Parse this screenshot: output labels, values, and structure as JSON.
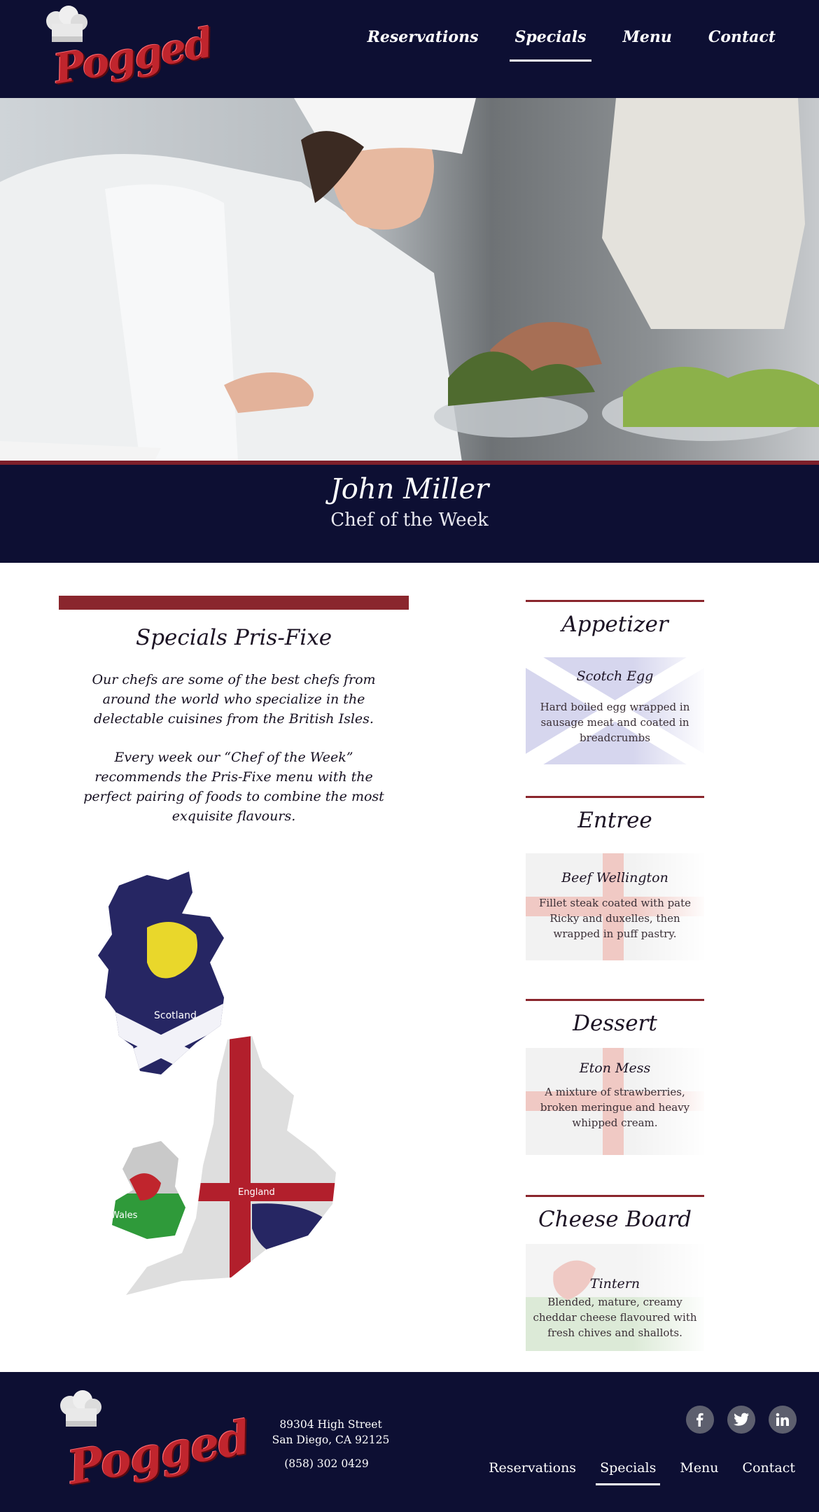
{
  "brand": {
    "logo_text": "Pogged"
  },
  "nav": {
    "items": [
      {
        "label": "Reservations",
        "active": false
      },
      {
        "label": "Specials",
        "active": true
      },
      {
        "label": "Menu",
        "active": false
      },
      {
        "label": "Contact",
        "active": false
      }
    ]
  },
  "hero": {
    "chef_name": "John Miller",
    "chef_role": "Chef of the Week"
  },
  "specials": {
    "title": "Specials Pris-Fixe",
    "paragraph_1": "Our chefs are some of the best chefs from around the world who specialize in the delectable cuisines from the British Isles.",
    "paragraph_2": "Every week our “Chef of the Week” recommends the Pris-Fixe menu with the perfect pairing of foods to combine the most exquisite flavours."
  },
  "map": {
    "labels": {
      "scotland": "Scotland",
      "england": "England",
      "wales": "Wales"
    }
  },
  "courses": [
    {
      "title": "Appetizer",
      "dish": "Scotch Egg",
      "description": "Hard boiled egg wrapped in sausage meat and coated in breadcrumbs",
      "flag": "scotland-flag"
    },
    {
      "title": "Entree",
      "dish": "Beef Wellington",
      "description": "Fillet steak coated with pate Ricky and duxelles, then wrapped in puff pastry.",
      "flag": "england-flag"
    },
    {
      "title": "Dessert",
      "dish": "Eton Mess",
      "description": "A mixture of strawberries, broken meringue and heavy whipped cream.",
      "flag": "england-flag"
    },
    {
      "title": "Cheese Board",
      "dish": "Tintern",
      "description": "Blended, mature, creamy cheddar cheese flavoured with fresh chives and shallots.",
      "flag": "wales-flag"
    }
  ],
  "footer": {
    "address_line_1": "89304 High Street",
    "address_line_2": "San Diego, CA 92125",
    "phone": "(858) 302 0429",
    "social": [
      "facebook-icon",
      "twitter-icon",
      "linkedin-icon"
    ],
    "nav": [
      {
        "label": "Reservations",
        "active": false
      },
      {
        "label": "Specials",
        "active": true
      },
      {
        "label": "Menu",
        "active": false
      },
      {
        "label": "Contact",
        "active": false
      }
    ]
  },
  "colors": {
    "navy": "#0d0f33",
    "accent_red": "#8a262d",
    "logo_red": "#c0252d"
  }
}
